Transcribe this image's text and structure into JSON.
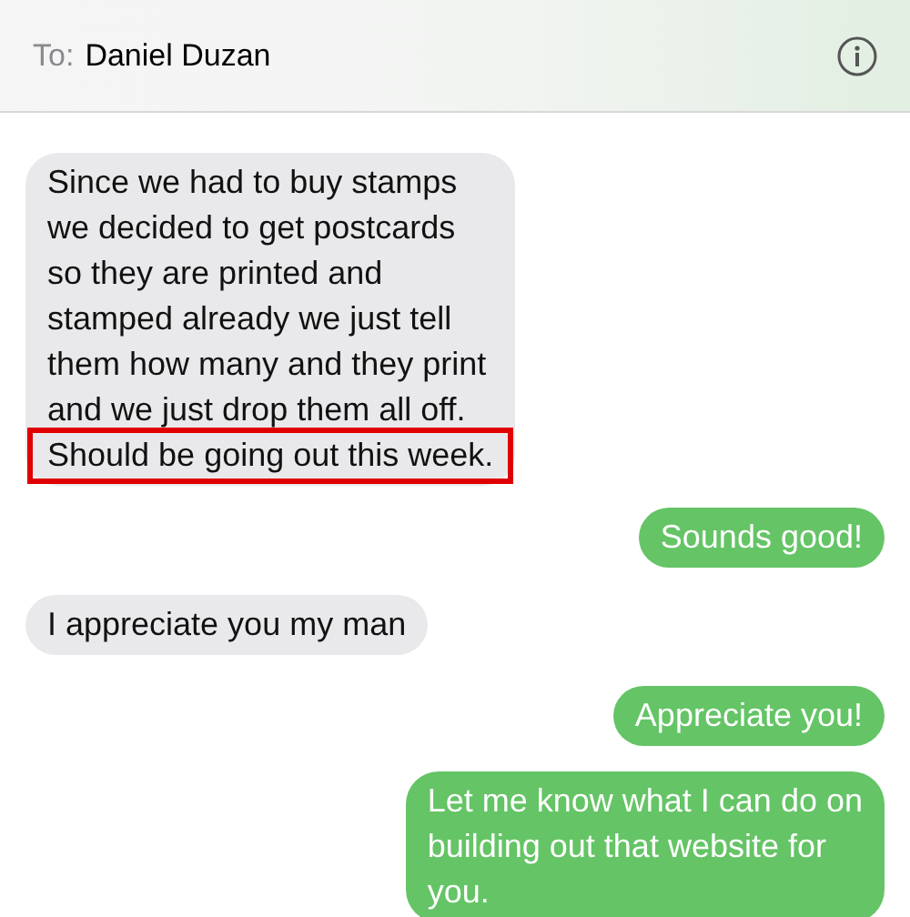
{
  "header": {
    "to_label": "To:",
    "recipient": "Daniel Duzan"
  },
  "messages": [
    {
      "sent": false,
      "lines": [
        {
          "text": "Since we had to buy stamps",
          "highlighted": false
        },
        {
          "text": "we decided to get postcards",
          "highlighted": false
        },
        {
          "text": "so they are printed and",
          "highlighted": false
        },
        {
          "text": "stamped already we just tell",
          "highlighted": false
        },
        {
          "text": "them how many and they print",
          "highlighted": false
        },
        {
          "text": "and we just drop them all off.",
          "highlighted": false
        },
        {
          "text": "Should be going out this week.",
          "highlighted": true
        }
      ]
    },
    {
      "sent": true,
      "lines": [
        {
          "text": "Sounds good!",
          "highlighted": false
        }
      ]
    },
    {
      "sent": false,
      "lines": [
        {
          "text": "I appreciate you my man",
          "highlighted": false
        }
      ]
    },
    {
      "sent": true,
      "lines": [
        {
          "text": "Appreciate you!",
          "highlighted": false
        }
      ]
    },
    {
      "sent": true,
      "lines": [
        {
          "text": "Let me know what I can do on",
          "highlighted": false
        },
        {
          "text": "building out that website for",
          "highlighted": false
        },
        {
          "text": "you.",
          "highlighted": false
        }
      ]
    }
  ]
}
